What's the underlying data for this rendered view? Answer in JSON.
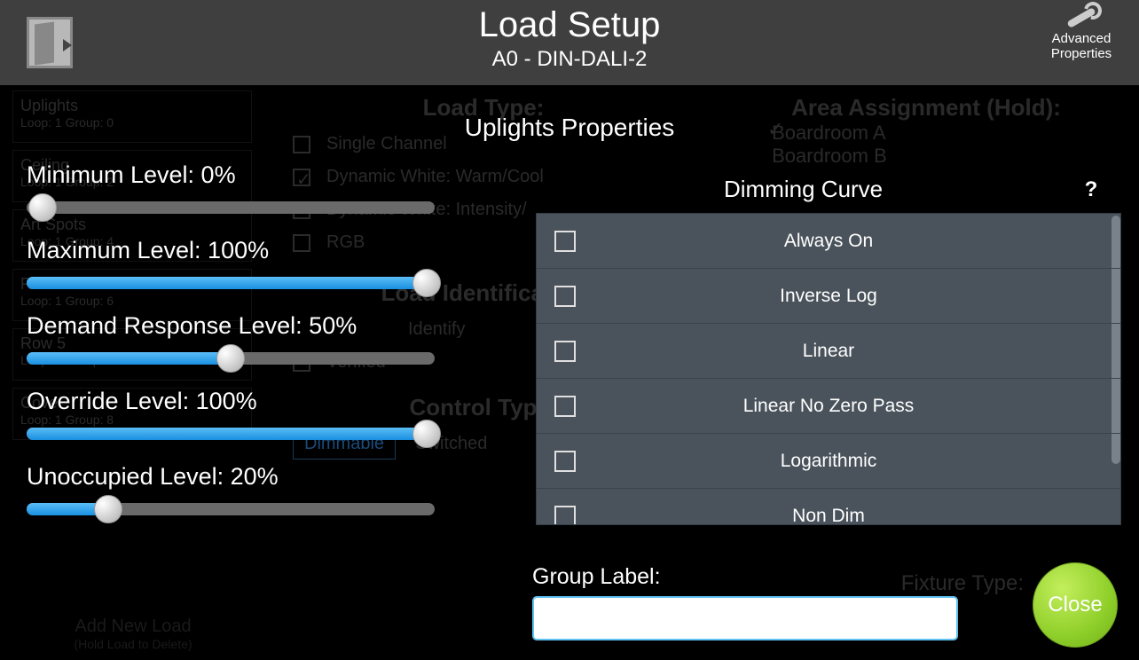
{
  "header": {
    "title": "Load Setup",
    "subtitle": "A0 - DIN-DALI-2",
    "advanced_label_1": "Advanced",
    "advanced_label_2": "Properties"
  },
  "panel_title": "Uplights Properties",
  "sliders": {
    "min": {
      "label": "Minimum Level: 0%",
      "value": 0
    },
    "max": {
      "label": "Maximum Level: 100%",
      "value": 100
    },
    "demand": {
      "label": "Demand Response Level: 50%",
      "value": 50
    },
    "override": {
      "label": "Override Level: 100%",
      "value": 100
    },
    "unocc": {
      "label": "Unoccupied Level: 20%",
      "value": 20
    }
  },
  "dimming_curve": {
    "title": "Dimming Curve",
    "help": "?",
    "options": [
      "Always On",
      "Inverse Log",
      "Linear",
      "Linear No Zero Pass",
      "Logarithmic",
      "Non Dim"
    ]
  },
  "group_label": {
    "label": "Group Label:",
    "value": ""
  },
  "close_label": "Close",
  "background": {
    "loads": [
      {
        "name": "Uplights",
        "sub": "Loop: 1 Group: 0"
      },
      {
        "name": "Ceiling",
        "sub": "Loop: 1 Group: 2"
      },
      {
        "name": "Art Spots",
        "sub": "Loop: 1 Group: 4"
      },
      {
        "name": "Row 4",
        "sub": "Loop: 1 Group: 6"
      },
      {
        "name": "Row 5",
        "sub": "Loop: 1 Group: 7"
      },
      {
        "name": "Cove",
        "sub": "Loop: 1 Group: 8"
      }
    ],
    "load_type_heading": "Load Type:",
    "load_type_opts": [
      "Single Channel",
      "Dynamic White: Warm/Cool",
      "Dynamic White: Intensity/",
      "RGB"
    ],
    "load_ident_heading": "Load Identification",
    "identify": "Identify",
    "verified": "Verified",
    "control_type_heading": "Control Type:",
    "control_opts": [
      "Dimmable",
      "Switched"
    ],
    "area_heading": "Area Assignment (Hold):",
    "area_opts": [
      "Boardroom A",
      "Boardroom B"
    ],
    "fixture_type": "Fixture Type:",
    "add_load": "Add New Load",
    "add_load_sub": "(Hold Load to Delete)"
  }
}
